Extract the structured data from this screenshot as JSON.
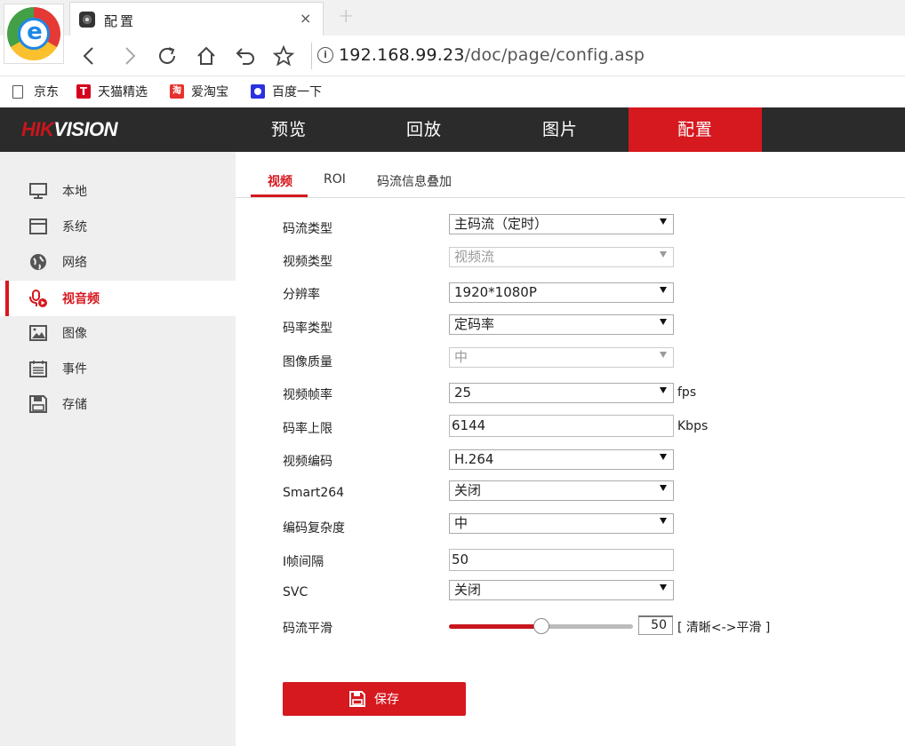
{
  "browser": {
    "tab_title": "配置",
    "tab_close": "×",
    "new_tab": "+",
    "url_host": "192.168.99.23",
    "url_path": "/doc/page/config.asp",
    "bookmarks": [
      {
        "label": "京东",
        "icon": "document-icon"
      },
      {
        "label": "天猫精选",
        "icon": "tmall-icon"
      },
      {
        "label": "爱淘宝",
        "icon": "taobao-icon"
      },
      {
        "label": "百度一下",
        "icon": "baidu-paw-icon"
      }
    ]
  },
  "header": {
    "brand_hik": "HIK",
    "brand_vision": "VISION",
    "tabs": [
      {
        "label": "预览",
        "active": false
      },
      {
        "label": "回放",
        "active": false
      },
      {
        "label": "图片",
        "active": false
      },
      {
        "label": "配置",
        "active": true
      }
    ],
    "accent_color": "#d6181f"
  },
  "sidebar": {
    "items": [
      {
        "label": "本地",
        "icon": "monitor-icon",
        "active": false
      },
      {
        "label": "系统",
        "icon": "window-icon",
        "active": false
      },
      {
        "label": "网络",
        "icon": "globe-icon",
        "active": false
      },
      {
        "label": "视音频",
        "icon": "microphone-video-icon",
        "active": true
      },
      {
        "label": "图像",
        "icon": "image-icon",
        "active": false
      },
      {
        "label": "事件",
        "icon": "calendar-icon",
        "active": false
      },
      {
        "label": "存储",
        "icon": "floppy-disk-icon",
        "active": false
      }
    ]
  },
  "subtabs": [
    {
      "label": "视频",
      "active": true
    },
    {
      "label": "ROI",
      "active": false
    },
    {
      "label": "码流信息叠加",
      "active": false
    }
  ],
  "form": {
    "stream_type": {
      "label": "码流类型",
      "value": "主码流（定时）"
    },
    "video_type": {
      "label": "视频类型",
      "value": "视频流"
    },
    "resolution": {
      "label": "分辨率",
      "value": "1920*1080P"
    },
    "bitrate_type": {
      "label": "码率类型",
      "value": "定码率"
    },
    "image_quality": {
      "label": "图像质量",
      "value": "中"
    },
    "frame_rate": {
      "label": "视频帧率",
      "value": "25",
      "unit": "fps"
    },
    "max_bitrate": {
      "label": "码率上限",
      "value": "6144",
      "unit": "Kbps"
    },
    "video_encoding": {
      "label": "视频编码",
      "value": "H.264"
    },
    "smart264": {
      "label": "Smart264",
      "value": "关闭"
    },
    "complexity": {
      "label": "编码复杂度",
      "value": "中"
    },
    "i_frame_interval": {
      "label": "I帧间隔",
      "value": "50"
    },
    "svc": {
      "label": "SVC",
      "value": "关闭"
    },
    "smoothing": {
      "label": "码流平滑",
      "value": "50",
      "value_fraction": 0.5,
      "hint": "[ 清晰<->平滑 ]"
    }
  },
  "save_label": "保存"
}
